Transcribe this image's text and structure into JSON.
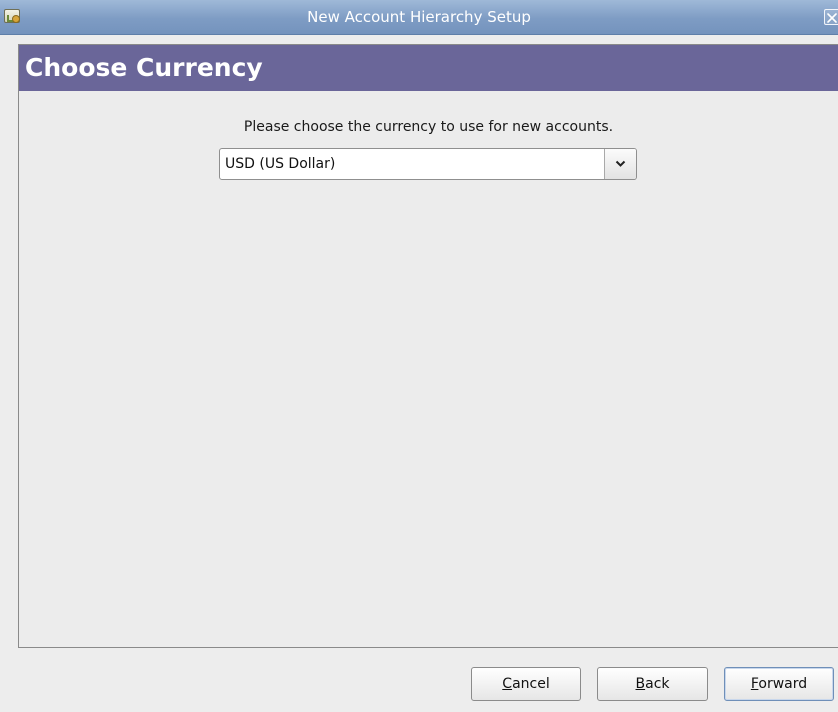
{
  "window": {
    "title": "New Account Hierarchy Setup",
    "icons": {
      "app": "gnucash-app-icon",
      "close": "close-icon"
    }
  },
  "page": {
    "title": "Choose Currency",
    "header_color": "#6a6699",
    "prompt": "Please choose the currency to use for new accounts.",
    "currency": {
      "selected": "USD (US Dollar)",
      "arrow_icon": "chevron-down-icon"
    }
  },
  "buttons": {
    "cancel": {
      "mnemonic": "C",
      "rest": "ancel"
    },
    "back": {
      "mnemonic": "B",
      "rest": "ack"
    },
    "forward": {
      "mnemonic": "F",
      "rest": "orward"
    }
  }
}
